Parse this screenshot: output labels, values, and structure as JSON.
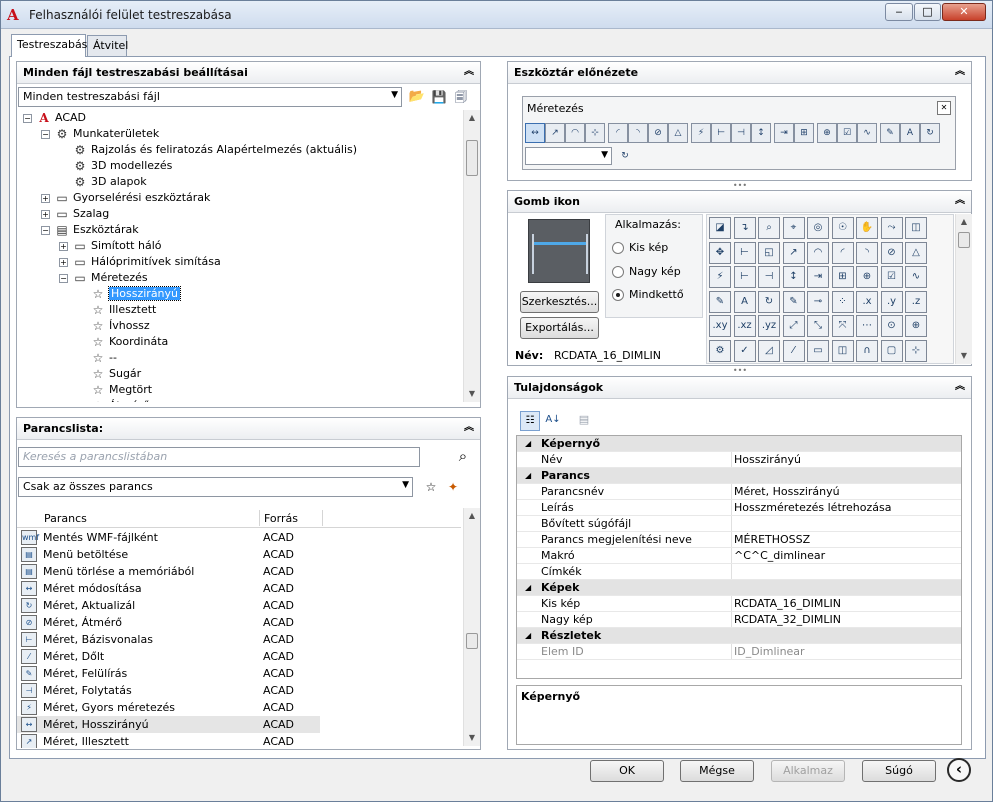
{
  "window": {
    "title": "Felhasználói felület testreszabása",
    "logo": "A",
    "minimize": "‒",
    "maximize": "□",
    "close": "✕"
  },
  "tabs": [
    {
      "label": "Testreszabás",
      "active": true
    },
    {
      "label": "Átvitel",
      "active": false
    }
  ],
  "customize_panel": {
    "title": "Minden fájl testreszabási beállításai",
    "file_combo": "Minden testreszabási fájl",
    "tree": [
      {
        "label": "ACAD",
        "level": 0,
        "expander": "−",
        "icon": "autocad-logo-icon"
      },
      {
        "label": "Munkaterületek",
        "level": 1,
        "expander": "−",
        "icon": "gear-icon"
      },
      {
        "label": "Rajzolás és feliratozás Alapértelmezés (aktuális)",
        "level": 2,
        "expander": "",
        "icon": "gear-icon"
      },
      {
        "label": "3D modellezés",
        "level": 2,
        "expander": "",
        "icon": "gear-icon"
      },
      {
        "label": "3D alapok",
        "level": 2,
        "expander": "",
        "icon": "gear-icon"
      },
      {
        "label": "Gyorselérési eszköztárak",
        "level": 1,
        "expander": "+",
        "icon": "quick-access-toolbar-icon"
      },
      {
        "label": "Szalag",
        "level": 1,
        "expander": "+",
        "icon": "ribbon-icon"
      },
      {
        "label": "Eszköztárak",
        "level": 1,
        "expander": "−",
        "icon": "toolbars-icon"
      },
      {
        "label": "Simított háló",
        "level": 2,
        "expander": "+",
        "icon": "toolbar-icon"
      },
      {
        "label": "Hálóprimitívek simítása",
        "level": 2,
        "expander": "+",
        "icon": "toolbar-icon"
      },
      {
        "label": "Méretezés",
        "level": 2,
        "expander": "−",
        "icon": "toolbar-icon"
      },
      {
        "label": "Hosszirányú",
        "level": 3,
        "expander": "",
        "icon": "star-icon",
        "selected": true
      },
      {
        "label": "Illesztett",
        "level": 3,
        "expander": "",
        "icon": "star-icon"
      },
      {
        "label": "Ívhossz",
        "level": 3,
        "expander": "",
        "icon": "star-icon"
      },
      {
        "label": "Koordináta",
        "level": 3,
        "expander": "",
        "icon": "star-icon"
      },
      {
        "label": "--",
        "level": 3,
        "expander": "",
        "icon": "star-icon"
      },
      {
        "label": "Sugár",
        "level": 3,
        "expander": "",
        "icon": "star-icon"
      },
      {
        "label": "Megtört",
        "level": 3,
        "expander": "",
        "icon": "star-icon"
      },
      {
        "label": "Átmérő",
        "level": 3,
        "expander": "",
        "icon": "star-icon"
      }
    ]
  },
  "command_panel": {
    "title": "Parancslista:",
    "search_placeholder": "Keresés a parancslistában",
    "filter_combo": "Csak az összes parancs",
    "col_command": "Parancs",
    "col_source": "Forrás",
    "rows": [
      {
        "name": "Mentés WMF-fájlként",
        "source": "ACAD",
        "icon": "wmf"
      },
      {
        "name": "Menü betöltése",
        "source": "ACAD",
        "icon": "▤"
      },
      {
        "name": "Menü törlése a memóriából",
        "source": "ACAD",
        "icon": "▤"
      },
      {
        "name": "Méret módosítása",
        "source": "ACAD",
        "icon": "↔"
      },
      {
        "name": "Méret, Aktualizál",
        "source": "ACAD",
        "icon": "↻"
      },
      {
        "name": "Méret, Átmérő",
        "source": "ACAD",
        "icon": "⊘"
      },
      {
        "name": "Méret, Bázisvonalas",
        "source": "ACAD",
        "icon": "⊢"
      },
      {
        "name": "Méret, Dőlt",
        "source": "ACAD",
        "icon": "⁄"
      },
      {
        "name": "Méret, Felülírás",
        "source": "ACAD",
        "icon": "✎"
      },
      {
        "name": "Méret, Folytatás",
        "source": "ACAD",
        "icon": "⊣"
      },
      {
        "name": "Méret, Gyors méretezés",
        "source": "ACAD",
        "icon": "⚡"
      },
      {
        "name": "Méret, Hosszirányú",
        "source": "ACAD",
        "icon": "↔",
        "selected": true
      },
      {
        "name": "Méret, Illesztett",
        "source": "ACAD",
        "icon": "↗"
      }
    ]
  },
  "toolbar_preview": {
    "title": "Eszköztár előnézete",
    "toolbar_name": "Méretezés",
    "close": "✕",
    "icons": [
      "↔",
      "↗",
      "◠",
      "⊹",
      "◜",
      "◝",
      "⊘",
      "△",
      "⚡",
      "⊢",
      "⊣",
      "↕",
      "⇥",
      "⊞",
      "⊕",
      "☑",
      "∿",
      "✎",
      "A",
      "↻"
    ]
  },
  "button_image": {
    "title": "Gomb ikon",
    "apply_label": "Alkalmazás:",
    "options": [
      {
        "label": "Kis kép",
        "checked": false
      },
      {
        "label": "Nagy kép",
        "checked": false
      },
      {
        "label": "Mindkettő",
        "checked": true
      }
    ],
    "edit_button": "Szerkesztés...",
    "export_button": "Exportálás...",
    "name_label": "Név:",
    "name_value": "RCDATA_16_DIMLIN",
    "grid_icons": [
      "◪",
      "↴",
      "⌕",
      "⌖",
      "◎",
      "☉",
      "✋",
      "⤳",
      "◫",
      "✥",
      "⊢",
      "◱",
      "↗",
      "◠",
      "◜",
      "◝",
      "⊘",
      "△",
      "⚡",
      "⊢",
      "⊣",
      "↕",
      "⇥",
      "⊞",
      "⊕",
      "☑",
      "∿",
      "✎",
      "A",
      "↻",
      "✎",
      "⊸",
      "⁘",
      ".x",
      ".y",
      ".z",
      ".xy",
      ".xz",
      ".yz",
      "⤢",
      "⤡",
      "⤧",
      "⋯",
      "⊙",
      "⊕",
      "⚙",
      "✓",
      "◿",
      "⁄",
      "▭",
      "◫",
      "∩",
      "▢",
      "⊹",
      "⌐",
      "✺"
    ]
  },
  "properties": {
    "title": "Tulajdonságok",
    "rows": [
      {
        "type": "cat",
        "key": "Képernyő"
      },
      {
        "type": "prop",
        "key": "Név",
        "value": "Hosszirányú"
      },
      {
        "type": "cat",
        "key": "Parancs"
      },
      {
        "type": "prop",
        "key": "Parancsnév",
        "value": "Méret, Hosszirányú"
      },
      {
        "type": "prop",
        "key": "Leírás",
        "value": "Hosszméretezés létrehozása"
      },
      {
        "type": "prop",
        "key": "Bővített súgófájl",
        "value": ""
      },
      {
        "type": "prop",
        "key": "Parancs megjelenítési neve",
        "value": "MÉRETHOSSZ"
      },
      {
        "type": "prop",
        "key": "Makró",
        "value": "^C^C_dimlinear"
      },
      {
        "type": "prop",
        "key": "Címkék",
        "value": ""
      },
      {
        "type": "cat",
        "key": "Képek"
      },
      {
        "type": "prop",
        "key": "Kis kép",
        "value": "RCDATA_16_DIMLIN"
      },
      {
        "type": "prop",
        "key": "Nagy kép",
        "value": "RCDATA_32_DIMLIN"
      },
      {
        "type": "cat",
        "key": "Részletek"
      },
      {
        "type": "prop",
        "key": "Elem ID",
        "value": "ID_Dimlinear",
        "disabled": true
      }
    ],
    "description_title": "Képernyő"
  },
  "footer": {
    "ok": "OK",
    "cancel": "Mégse",
    "apply": "Alkalmaz",
    "help": "Súgó",
    "collapse": "‹"
  }
}
